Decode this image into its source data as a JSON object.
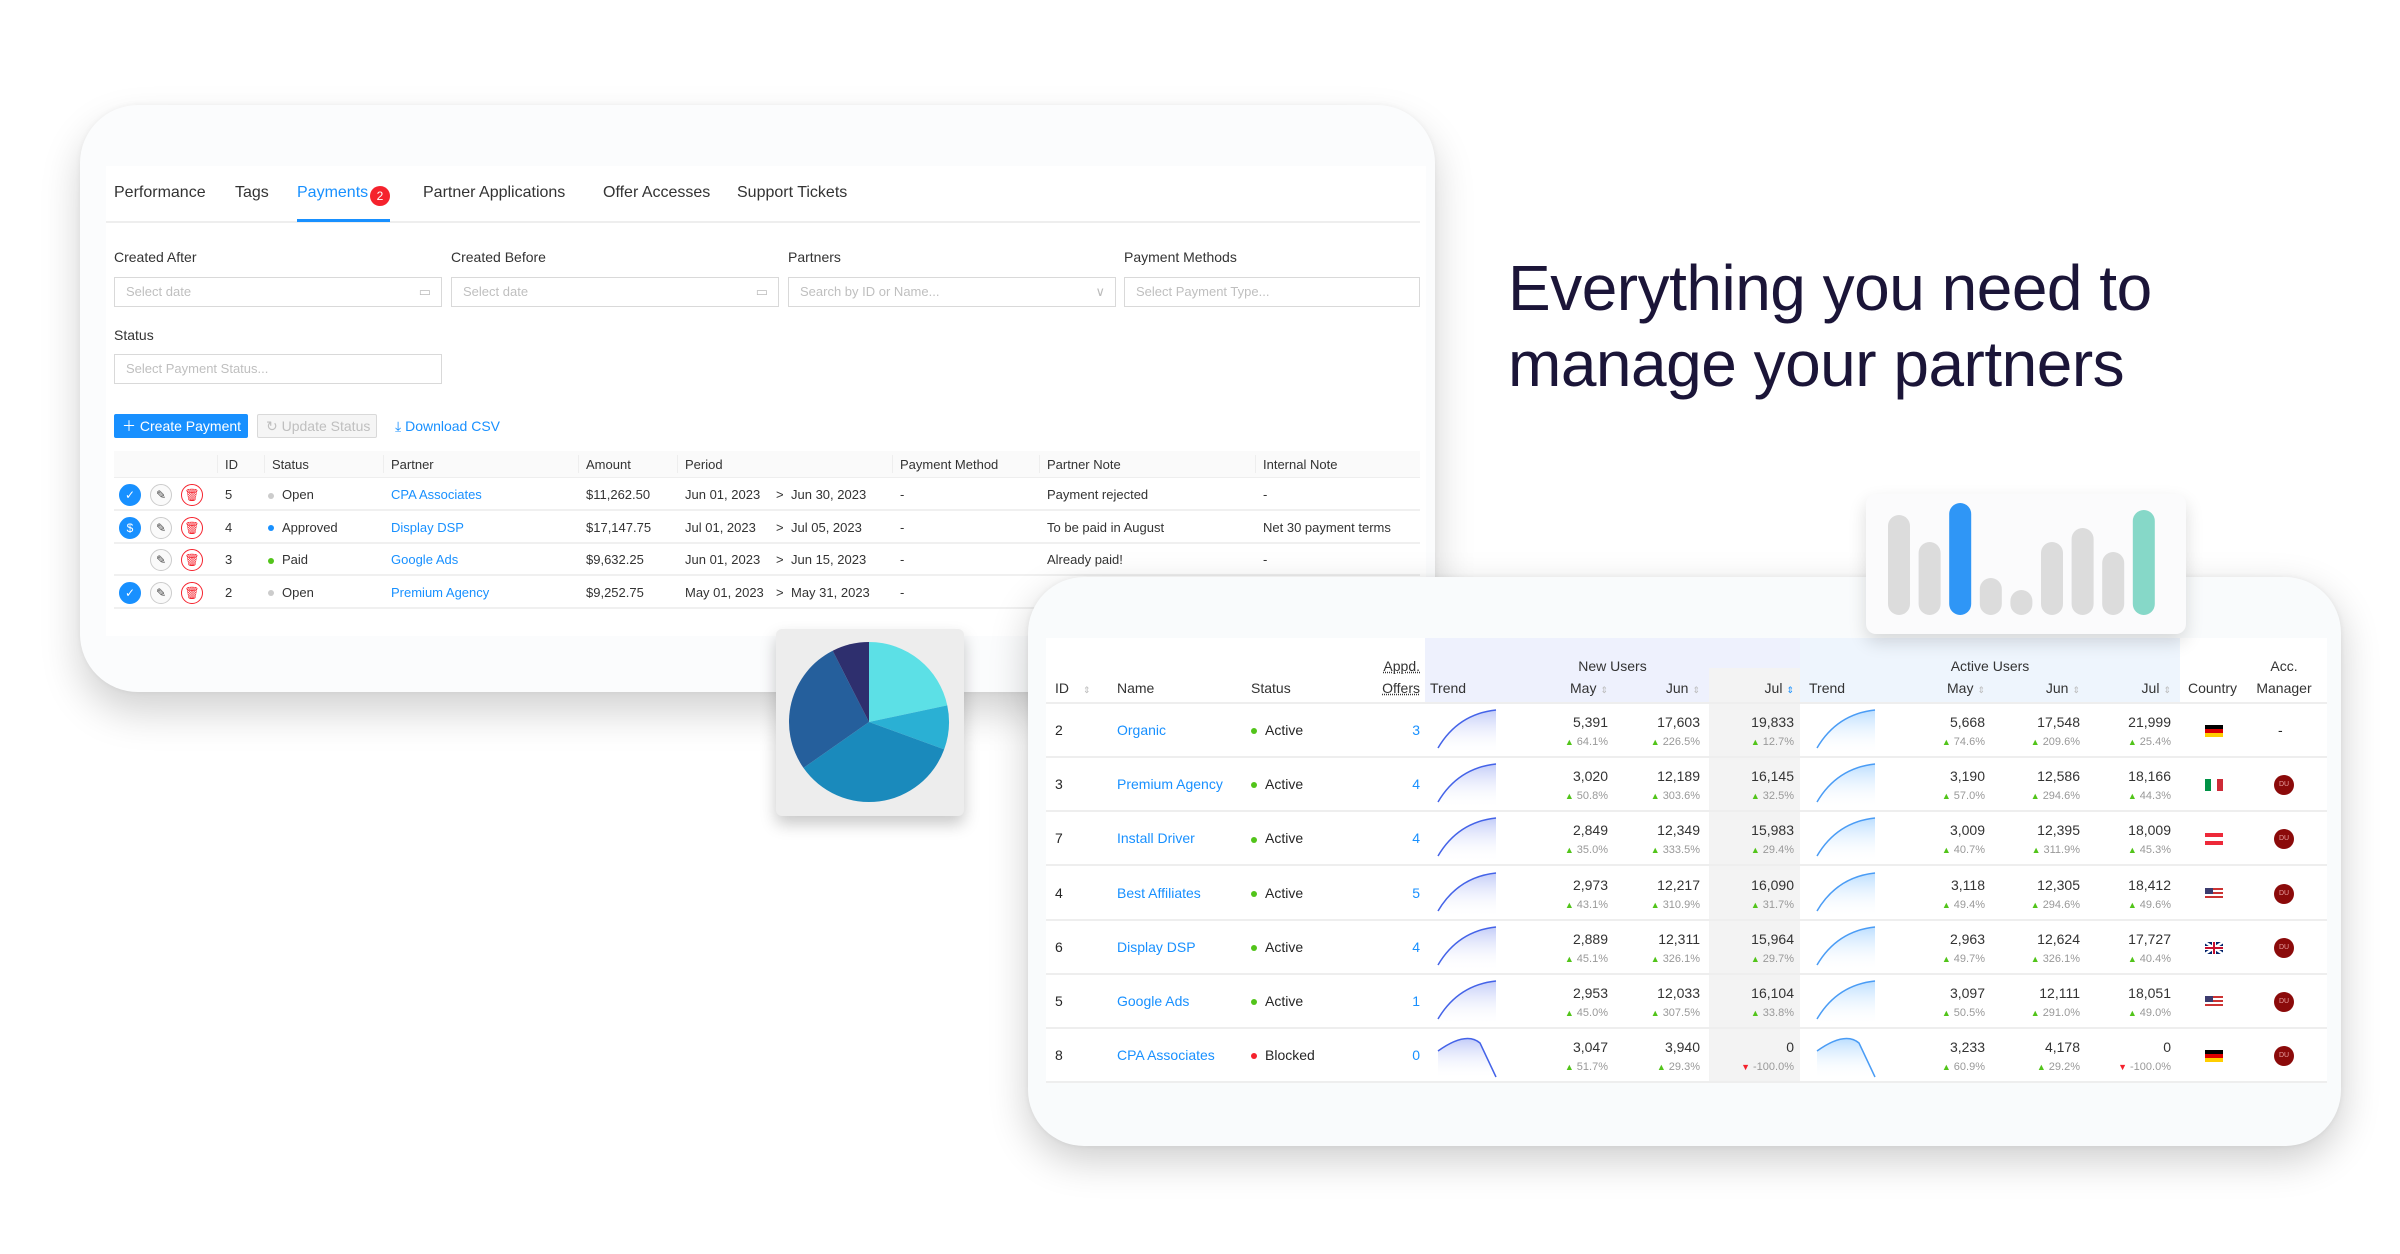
{
  "headline": {
    "line1": "Everything you need to",
    "line2": "manage your partners"
  },
  "payments_panel": {
    "tabs": [
      {
        "label": "Performance"
      },
      {
        "label": "Tags"
      },
      {
        "label": "Payments",
        "badge": "2",
        "active": true
      },
      {
        "label": "Partner Applications"
      },
      {
        "label": "Offer Accesses"
      },
      {
        "label": "Support Tickets"
      }
    ],
    "filters": {
      "created_after": {
        "label": "Created After",
        "placeholder": "Select date"
      },
      "created_before": {
        "label": "Created Before",
        "placeholder": "Select date"
      },
      "partners": {
        "label": "Partners",
        "placeholder": "Search by ID or Name..."
      },
      "payment_methods": {
        "label": "Payment Methods",
        "placeholder": "Select Payment Type..."
      },
      "status": {
        "label": "Status",
        "placeholder": "Select Payment Status..."
      }
    },
    "actions": {
      "create": "Create Payment",
      "update": "Update Status",
      "download": "Download CSV"
    },
    "columns": [
      "ID",
      "Status",
      "Partner",
      "Amount",
      "Period",
      "Payment Method",
      "Partner Note",
      "Internal Note"
    ],
    "rows": [
      {
        "actions": [
          "check",
          "edit",
          "delete"
        ],
        "id": "5",
        "status": "Open",
        "status_color": "#cccccc",
        "partner": "CPA Associates",
        "amount": "$11,262.50",
        "period_start": "Jun 01, 2023",
        "period_end": "Jun 30, 2023",
        "method": "-",
        "partner_note": "Payment rejected",
        "internal_note": "-"
      },
      {
        "actions": [
          "pay",
          "edit",
          "delete"
        ],
        "id": "4",
        "status": "Approved",
        "status_color": "#1890ff",
        "partner": "Display DSP",
        "amount": "$17,147.75",
        "period_start": "Jul 01, 2023",
        "period_end": "Jul 05, 2023",
        "method": "-",
        "partner_note": "To be paid in August",
        "internal_note": "Net 30 payment terms"
      },
      {
        "actions": [
          "edit",
          "delete"
        ],
        "id": "3",
        "status": "Paid",
        "status_color": "#52c41a",
        "partner": "Google Ads",
        "amount": "$9,632.25",
        "period_start": "Jun 01, 2023",
        "period_end": "Jun 15, 2023",
        "method": "-",
        "partner_note": "Already paid!",
        "internal_note": "-"
      },
      {
        "actions": [
          "check",
          "edit",
          "delete"
        ],
        "id": "2",
        "status": "Open",
        "status_color": "#cccccc",
        "partner": "Premium Agency",
        "amount": "$9,252.75",
        "period_start": "May 01, 2023",
        "period_end": "May 31, 2023",
        "method": "-",
        "partner_note": "",
        "internal_note": ""
      }
    ]
  },
  "pie_widget": {
    "colors": [
      "#5ce0e6",
      "#2ab0d4",
      "#1a8abc",
      "#255f9c",
      "#2e2f6e"
    ],
    "slice_degrees": [
      78,
      32,
      125,
      98,
      27
    ]
  },
  "bar_widget": {
    "relative_values": [
      100,
      73,
      112,
      37,
      25,
      73,
      87,
      63,
      105
    ],
    "highlight": {
      "2": "#2f96f6",
      "8": "#86d8c8"
    },
    "base_color": "#dcdcdc"
  },
  "partners_panel": {
    "group_headers": {
      "new_users": "New Users",
      "active_users": "Active Users"
    },
    "columns": {
      "id": "ID",
      "name": "Name",
      "status": "Status",
      "offers_line1": "Appd.",
      "offers_line2": "Offers",
      "trend": "Trend",
      "may": "May",
      "jun": "Jun",
      "jul": "Jul",
      "country": "Country",
      "manager_line1": "Acc.",
      "manager_line2": "Manager"
    },
    "rows": [
      {
        "id": "2",
        "name": "Organic",
        "status": "Active",
        "offers": "3",
        "new": [
          [
            "5,391",
            "64.1%"
          ],
          [
            "17,603",
            "226.5%"
          ],
          [
            "19,833",
            "12.7%"
          ]
        ],
        "active": [
          [
            "5,668",
            "74.6%"
          ],
          [
            "17,548",
            "209.6%"
          ],
          [
            "21,999",
            "25.4%"
          ]
        ],
        "country": "DE",
        "manager": "-"
      },
      {
        "id": "3",
        "name": "Premium Agency",
        "status": "Active",
        "offers": "4",
        "new": [
          [
            "3,020",
            "50.8%"
          ],
          [
            "12,189",
            "303.6%"
          ],
          [
            "16,145",
            "32.5%"
          ]
        ],
        "active": [
          [
            "3,190",
            "57.0%"
          ],
          [
            "12,586",
            "294.6%"
          ],
          [
            "18,166",
            "44.3%"
          ]
        ],
        "country": "IT",
        "manager": "DU"
      },
      {
        "id": "7",
        "name": "Install Driver",
        "status": "Active",
        "offers": "4",
        "new": [
          [
            "2,849",
            "35.0%"
          ],
          [
            "12,349",
            "333.5%"
          ],
          [
            "15,983",
            "29.4%"
          ]
        ],
        "active": [
          [
            "3,009",
            "40.7%"
          ],
          [
            "12,395",
            "311.9%"
          ],
          [
            "18,009",
            "45.3%"
          ]
        ],
        "country": "AT",
        "manager": "DU"
      },
      {
        "id": "4",
        "name": "Best Affiliates",
        "status": "Active",
        "offers": "5",
        "new": [
          [
            "2,973",
            "43.1%"
          ],
          [
            "12,217",
            "310.9%"
          ],
          [
            "16,090",
            "31.7%"
          ]
        ],
        "active": [
          [
            "3,118",
            "49.4%"
          ],
          [
            "12,305",
            "294.6%"
          ],
          [
            "18,412",
            "49.6%"
          ]
        ],
        "country": "US",
        "manager": "DU"
      },
      {
        "id": "6",
        "name": "Display DSP",
        "status": "Active",
        "offers": "4",
        "new": [
          [
            "2,889",
            "45.1%"
          ],
          [
            "12,311",
            "326.1%"
          ],
          [
            "15,964",
            "29.7%"
          ]
        ],
        "active": [
          [
            "2,963",
            "49.7%"
          ],
          [
            "12,624",
            "326.1%"
          ],
          [
            "17,727",
            "40.4%"
          ]
        ],
        "country": "GB",
        "manager": "DU"
      },
      {
        "id": "5",
        "name": "Google Ads",
        "status": "Active",
        "offers": "1",
        "new": [
          [
            "2,953",
            "45.0%"
          ],
          [
            "12,033",
            "307.5%"
          ],
          [
            "16,104",
            "33.8%"
          ]
        ],
        "active": [
          [
            "3,097",
            "50.5%"
          ],
          [
            "12,111",
            "291.0%"
          ],
          [
            "18,051",
            "49.0%"
          ]
        ],
        "country": "US",
        "manager": "DU"
      },
      {
        "id": "8",
        "name": "CPA Associates",
        "status": "Blocked",
        "offers": "0",
        "new": [
          [
            "3,047",
            "51.7%"
          ],
          [
            "3,940",
            "29.3%"
          ],
          [
            "0",
            "-100.0%"
          ]
        ],
        "active": [
          [
            "3,233",
            "60.9%"
          ],
          [
            "4,178",
            "29.2%"
          ],
          [
            "0",
            "-100.0%"
          ]
        ],
        "country": "DE",
        "manager": "DU"
      }
    ],
    "colors": {
      "active": "#52c41a",
      "blocked": "#f5222d",
      "link": "#1890ff",
      "manager_avatar": "#8b0a0a"
    }
  }
}
